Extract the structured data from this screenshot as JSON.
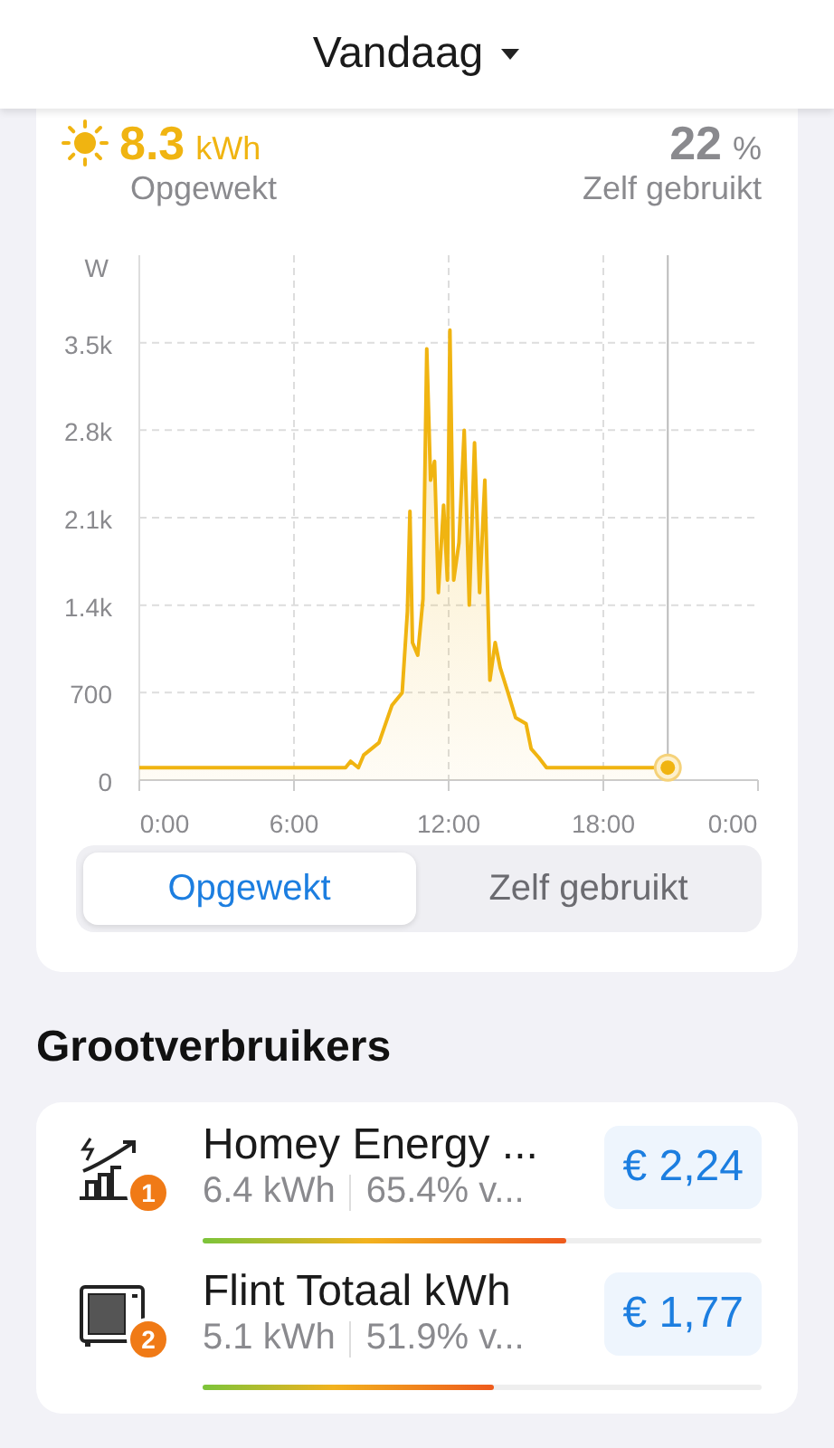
{
  "header": {
    "title": "Vandaag"
  },
  "summary": {
    "produced_value": "8.3",
    "produced_unit": "kWh",
    "produced_label": "Opgewekt",
    "self_value": "22",
    "self_unit": "%",
    "self_label": "Zelf gebruikt"
  },
  "chart": {
    "chart_data": {
      "type": "area",
      "ylabel": "W",
      "ylim": [
        0,
        4200
      ],
      "xlim": [
        0,
        24
      ],
      "grid": true,
      "ref_lines": [
        {
          "axis": "x",
          "value": 20.5
        }
      ],
      "yticks": [
        {
          "value": 0,
          "label": "0"
        },
        {
          "value": 700,
          "label": "700"
        },
        {
          "value": 1400,
          "label": "1.4k"
        },
        {
          "value": 2100,
          "label": "2.1k"
        },
        {
          "value": 2800,
          "label": "2.8k"
        },
        {
          "value": 3500,
          "label": "3.5k"
        }
      ],
      "xticks": [
        {
          "value": 0,
          "label": "0:00"
        },
        {
          "value": 6,
          "label": "6:00"
        },
        {
          "value": 12,
          "label": "12:00"
        },
        {
          "value": 18,
          "label": "18:00"
        },
        {
          "value": 24,
          "label": "0:00"
        }
      ],
      "x": [
        0,
        8,
        8.2,
        8.5,
        8.7,
        9.3,
        9.8,
        10.2,
        10.4,
        10.5,
        10.6,
        10.8,
        11,
        11.15,
        11.3,
        11.45,
        11.6,
        11.8,
        11.95,
        12.05,
        12.2,
        12.4,
        12.6,
        12.8,
        13,
        13.2,
        13.4,
        13.6,
        13.8,
        14,
        14.3,
        14.6,
        15,
        15.2,
        15.5,
        15.8,
        20.5
      ],
      "series": [
        {
          "color": "#f0b411",
          "values": [
            100,
            100,
            150,
            100,
            200,
            300,
            600,
            700,
            1350,
            2150,
            1100,
            1000,
            1450,
            3450,
            2400,
            2550,
            1500,
            2200,
            1600,
            3600,
            1600,
            1900,
            2800,
            1400,
            2700,
            1500,
            2400,
            800,
            1100,
            900,
            700,
            500,
            450,
            250,
            180,
            100,
            100
          ]
        }
      ]
    }
  },
  "segments": [
    {
      "label": "Opgewekt",
      "selected": true
    },
    {
      "label": "Zelf gebruikt",
      "selected": false
    }
  ],
  "section_title": "Grootverbruikers",
  "consumers": [
    {
      "kind": "chart",
      "rank": "1",
      "name": "Homey Energy ...",
      "energy": "6.4 kWh",
      "share": "65.4% v...",
      "cost": "€ 2,24",
      "level": 0.65
    },
    {
      "kind": "heat-pump",
      "rank": "2",
      "name": "Flint Totaal kWh",
      "energy": "5.1 kWh",
      "share": "51.9% v...",
      "cost": "€ 1,77",
      "level": 0.52
    }
  ]
}
